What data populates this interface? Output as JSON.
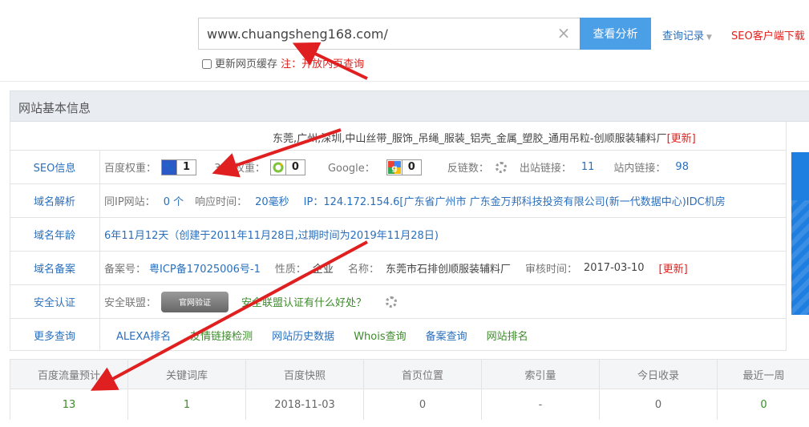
{
  "search": {
    "value": "www.chuangsheng168.com/",
    "clear_glyph": "×",
    "button": "查看分析",
    "history": "查询记录",
    "client_download": "SEO客户端下载",
    "cache_label": "更新网页缓存",
    "cache_note": "注：开放内页查询"
  },
  "panel": {
    "title": "网站基本信息",
    "site_title": "东莞,广州,深圳,中山丝带_服饰_吊绳_服装_铝壳_金属_塑胶_通用吊粒-创顺服装辅料厂",
    "refresh": "[更新]"
  },
  "seo": {
    "label": "SEO信息",
    "baidu_label": "百度权重：",
    "baidu_value": "1",
    "so_label": "360权重：",
    "so_value": "0",
    "google_label": "Google：",
    "google_value": "0",
    "backlinks_label": "反链数：",
    "outlinks_label": "出站链接：",
    "outlinks_value": "11",
    "inlinks_label": "站内链接：",
    "inlinks_value": "98"
  },
  "dns": {
    "label": "域名解析",
    "same_ip_label": "同IP网站：",
    "same_ip_value": "0 个",
    "response_label": "响应时间：",
    "response_value": "20毫秒",
    "ip_text": "IP：124.172.154.6[广东省广州市 广东金万邦科技投资有限公司(新一代数据中心)IDC机房"
  },
  "age": {
    "label": "域名年龄",
    "text": "6年11月12天（创建于2011年11月28日,过期时间为2019年11月28日)"
  },
  "icp": {
    "label": "域名备案",
    "no_label": "备案号：",
    "no_value": "粤ICP备17025006号-1",
    "type_label": "性质：",
    "type_value": "企业",
    "name_label": "名称：",
    "name_value": "东莞市石排创顺服装辅料厂",
    "time_label": "审核时间：",
    "time_value": "2017-03-10",
    "refresh": "[更新]"
  },
  "security": {
    "label": "安全认证",
    "alliance_label": "安全联盟：",
    "seal_text": "官网验证",
    "benefit_link": "安全联盟认证有什么好处？"
  },
  "more": {
    "label": "更多查询",
    "links": [
      "ALEXA排名",
      "友情链接检测",
      "网站历史数据",
      "Whois查询",
      "备案查询",
      "网站排名"
    ]
  },
  "stats": {
    "headers": [
      "百度流量预计",
      "关键词库",
      "百度快照",
      "首页位置",
      "索引量",
      "今日收录",
      "最近一周"
    ],
    "values": [
      "13",
      "1",
      "2018-11-03",
      "0",
      "-",
      "0",
      "0"
    ]
  },
  "colors": {
    "accent_blue": "#4a9fe6",
    "link_blue": "#2a6fbd",
    "warning_red": "#e0201d",
    "ok_green": "#3d8a2b",
    "annotation_red": "#e02020"
  }
}
